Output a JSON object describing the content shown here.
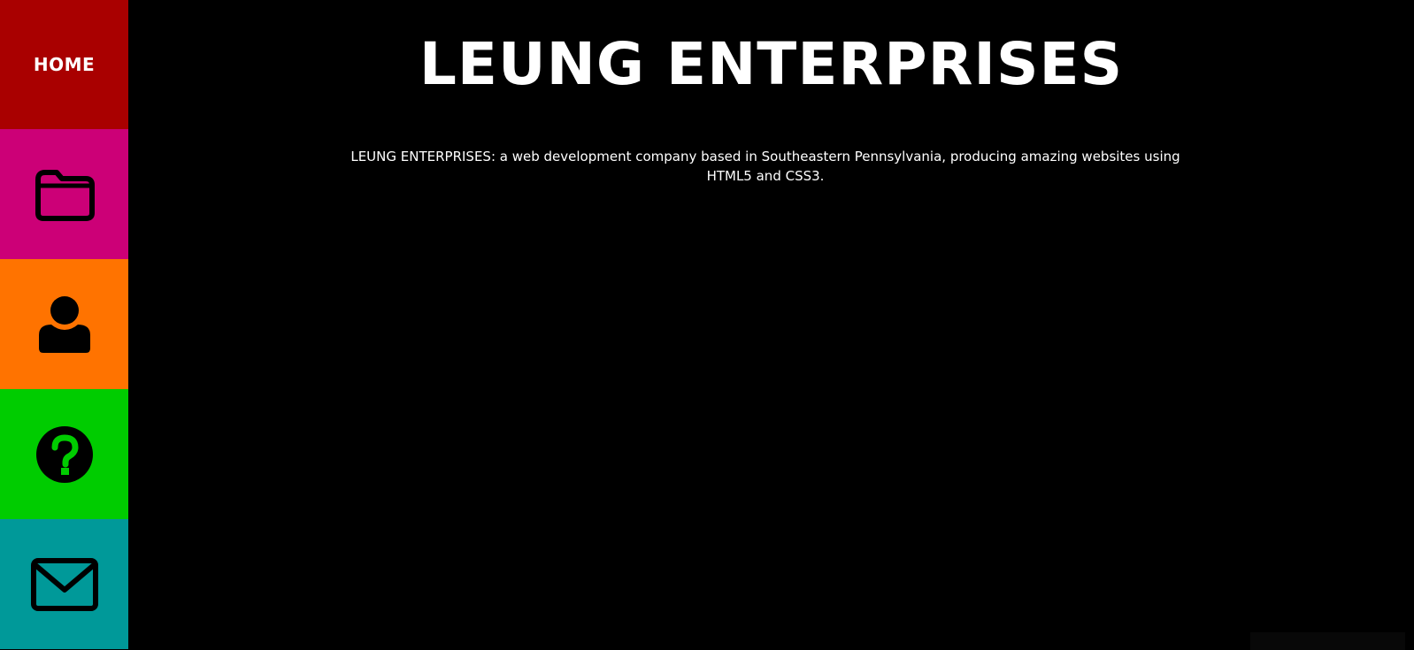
{
  "sidebar": {
    "items": [
      {
        "label": "HOME",
        "icon": "home-label",
        "color": "#a90000"
      },
      {
        "label": "",
        "icon": "folder-icon",
        "color": "#cc0077"
      },
      {
        "label": "",
        "icon": "user-icon",
        "color": "#ff7300"
      },
      {
        "label": "",
        "icon": "question-circle-icon",
        "color": "#00cc00"
      },
      {
        "label": "",
        "icon": "envelope-icon",
        "color": "#009999"
      }
    ]
  },
  "main": {
    "title": "LEUNG ENTERPRISES",
    "intro": "LEUNG ENTERPRISES: a web development company based in Southeastern Pennsylvania, producing amazing websites using HTML5 and CSS3."
  },
  "colors": {
    "background": "#000000",
    "text": "#ffffff",
    "icon": "#000000"
  }
}
